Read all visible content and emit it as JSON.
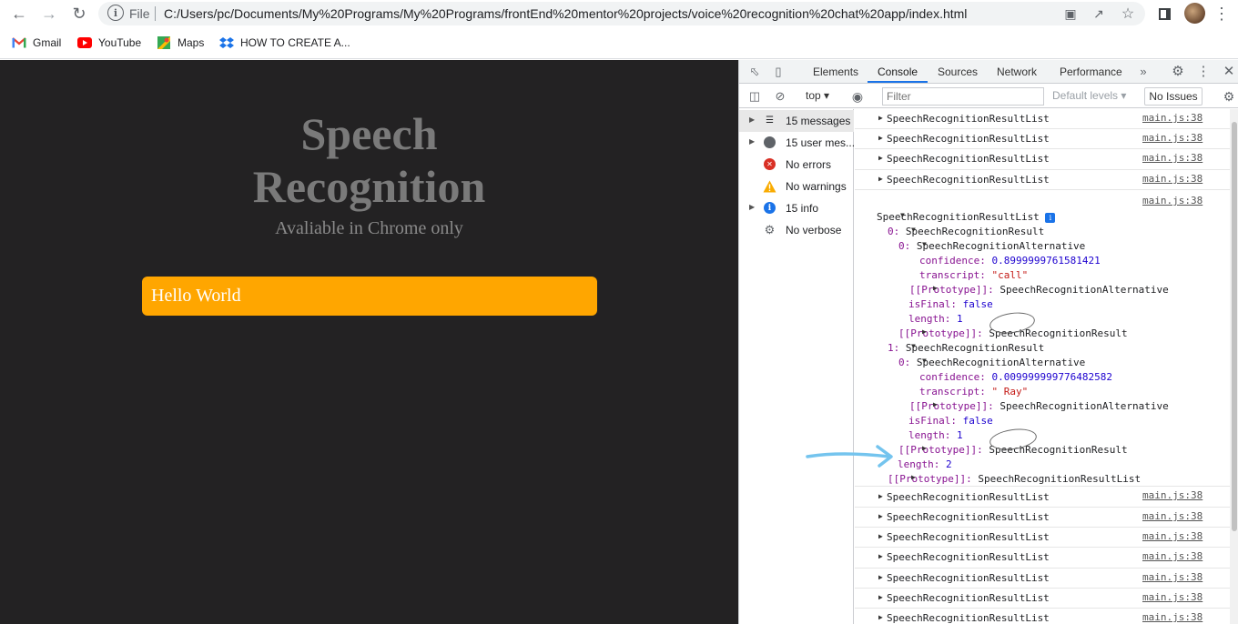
{
  "browser": {
    "url_scheme": "File",
    "url": "C:/Users/pc/Documents/My%20Programs/My%20Programs/frontEnd%20mentor%20projects/voice%20recognition%20chat%20app/index.html",
    "bookmarks": [
      {
        "label": "Gmail",
        "icon": "gmail-icon"
      },
      {
        "label": "YouTube",
        "icon": "youtube-icon"
      },
      {
        "label": "Maps",
        "icon": "maps-icon"
      },
      {
        "label": "HOW TO CREATE A...",
        "icon": "dropbox-icon"
      }
    ]
  },
  "page": {
    "title_line1": "Speech",
    "title_line2": "Recognition",
    "subtitle": "Avaliable in Chrome only",
    "result_text": "Hello World",
    "background": "#232223",
    "accent": "#ffa600"
  },
  "devtools": {
    "tabs": [
      "Elements",
      "Console",
      "Sources",
      "Network",
      "Performance"
    ],
    "active_tab": "Console",
    "context": "top",
    "filter_placeholder": "Filter",
    "levels_label": "Default levels",
    "issues_label": "No Issues",
    "sidebar": [
      {
        "label": "15 messages",
        "icon": "list-icon",
        "expandable": true
      },
      {
        "label": "15 user mes...",
        "icon": "user-icon",
        "expandable": true
      },
      {
        "label": "No errors",
        "icon": "error-icon",
        "expandable": false
      },
      {
        "label": "No warnings",
        "icon": "warning-icon",
        "expandable": false
      },
      {
        "label": "15 info",
        "icon": "info-icon",
        "expandable": true
      },
      {
        "label": "No verbose",
        "icon": "bug-icon",
        "expandable": false
      }
    ],
    "console": {
      "message_text": "SpeechRecognitionResultList",
      "source": "main.js:38",
      "expanded": {
        "header": "SpeechRecognitionResultList",
        "lines": [
          {
            "key": "0",
            "value": "SpeechRecognitionResult"
          },
          {
            "key": "0",
            "value": "SpeechRecognitionAlternative"
          },
          {
            "key": "confidence",
            "value": "0.8999999761581421"
          },
          {
            "key": "transcript",
            "value": "\"call\""
          },
          {
            "key": "[[Prototype]]",
            "value": "SpeechRecognitionAlternative"
          },
          {
            "key": "isFinal",
            "value": "false"
          },
          {
            "key": "length",
            "value": "1"
          },
          {
            "key": "[[Prototype]]",
            "value": "SpeechRecognitionResult"
          },
          {
            "key": "1",
            "value": "SpeechRecognitionResult"
          },
          {
            "key": "0",
            "value": "SpeechRecognitionAlternative"
          },
          {
            "key": "confidence",
            "value": "0.009999999776482582"
          },
          {
            "key": "transcript",
            "value": "\" Ray\""
          },
          {
            "key": "[[Prototype]]",
            "value": "SpeechRecognitionAlternative"
          },
          {
            "key": "isFinal",
            "value": "false"
          },
          {
            "key": "length",
            "value": "1"
          },
          {
            "key": "[[Prototype]]",
            "value": "SpeechRecognitionResult"
          },
          {
            "key": "length",
            "value": "2"
          },
          {
            "key": "[[Prototype]]",
            "value": "SpeechRecognitionResultList"
          }
        ]
      }
    }
  }
}
